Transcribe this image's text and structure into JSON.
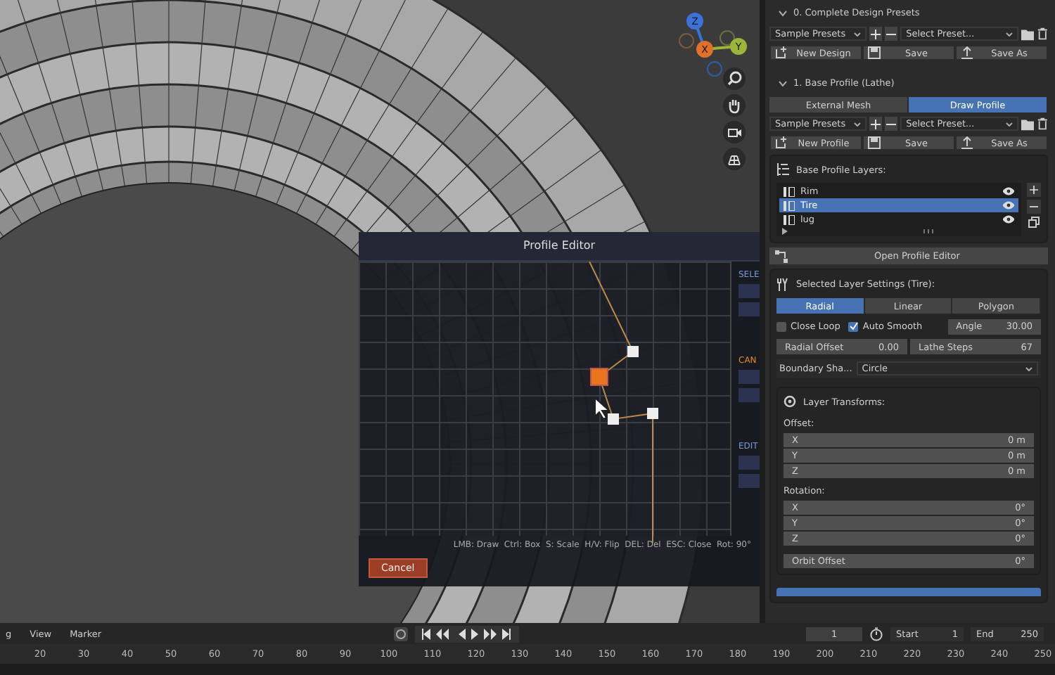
{
  "gizmo": {
    "axes": [
      "Z",
      "X",
      "Y"
    ]
  },
  "presets": {
    "title": "0. Complete Design Presets",
    "expanded": true,
    "library": "Sample Presets",
    "preset": "Select Preset...",
    "buttons": [
      "New Design",
      "Save",
      "Save As"
    ]
  },
  "base_profile": {
    "title": "1. Base Profile (Lathe)",
    "expanded": true,
    "mode_tabs": [
      {
        "label": "External Mesh",
        "selected": false
      },
      {
        "label": "Draw Profile",
        "selected": true
      }
    ],
    "library": "Sample Presets",
    "preset": "Select Preset...",
    "buttons": [
      "New Profile",
      "Save",
      "Save As"
    ]
  },
  "layers": {
    "title": "Base Profile Layers:",
    "items": [
      {
        "name": "Rim",
        "selected": false,
        "visible": true
      },
      {
        "name": "Tire",
        "selected": true,
        "visible": true
      },
      {
        "name": "lug",
        "selected": false,
        "visible": true
      }
    ],
    "open_button": "Open Profile Editor"
  },
  "layer_settings": {
    "title": "Selected Layer Settings (Tire):",
    "type_tabs": [
      {
        "label": "Radial",
        "selected": true
      },
      {
        "label": "Linear",
        "selected": false
      },
      {
        "label": "Polygon",
        "selected": false
      }
    ],
    "close_loop": {
      "label": "Close Loop",
      "checked": false
    },
    "auto_smooth": {
      "label": "Auto Smooth",
      "checked": true
    },
    "angle": {
      "label": "Angle",
      "value": "30.00"
    },
    "radial_offset": {
      "label": "Radial Offset",
      "value": "0.00"
    },
    "lathe_steps": {
      "label": "Lathe Steps",
      "value": "67"
    },
    "boundary": {
      "label": "Boundary Sha...",
      "value": "Circle"
    }
  },
  "transforms": {
    "title": "Layer Transforms:",
    "offset_label": "Offset:",
    "offset": [
      {
        "axis": "X",
        "value": "0 m"
      },
      {
        "axis": "Y",
        "value": "0 m"
      },
      {
        "axis": "Z",
        "value": "0 m"
      }
    ],
    "rotation_label": "Rotation:",
    "rotation": [
      {
        "axis": "X",
        "value": "0°"
      },
      {
        "axis": "Y",
        "value": "0°"
      },
      {
        "axis": "Z",
        "value": "0°"
      }
    ],
    "orbit": {
      "label": "Orbit Offset",
      "value": "0°"
    }
  },
  "profile_editor": {
    "title": "Profile Editor",
    "side_labels": [
      "SELE",
      "CAN",
      "EDIT"
    ],
    "hint": "LMB: Draw  Ctrl: Box  S: Scale  H/V: Flip  DEL: Del  ESC: Close  Rot: 90°",
    "cancel": "Cancel"
  },
  "timeline": {
    "menus": [
      "g",
      "View",
      "Marker"
    ],
    "frame": "1",
    "start_label": "Start",
    "start": "1",
    "end_label": "End",
    "end": "250",
    "ticks": [
      "20",
      "30",
      "40",
      "50",
      "60",
      "70",
      "80",
      "90",
      "100",
      "110",
      "120",
      "130",
      "140",
      "150",
      "160",
      "170",
      "180",
      "190",
      "200",
      "210",
      "220",
      "230",
      "240",
      "250"
    ]
  }
}
